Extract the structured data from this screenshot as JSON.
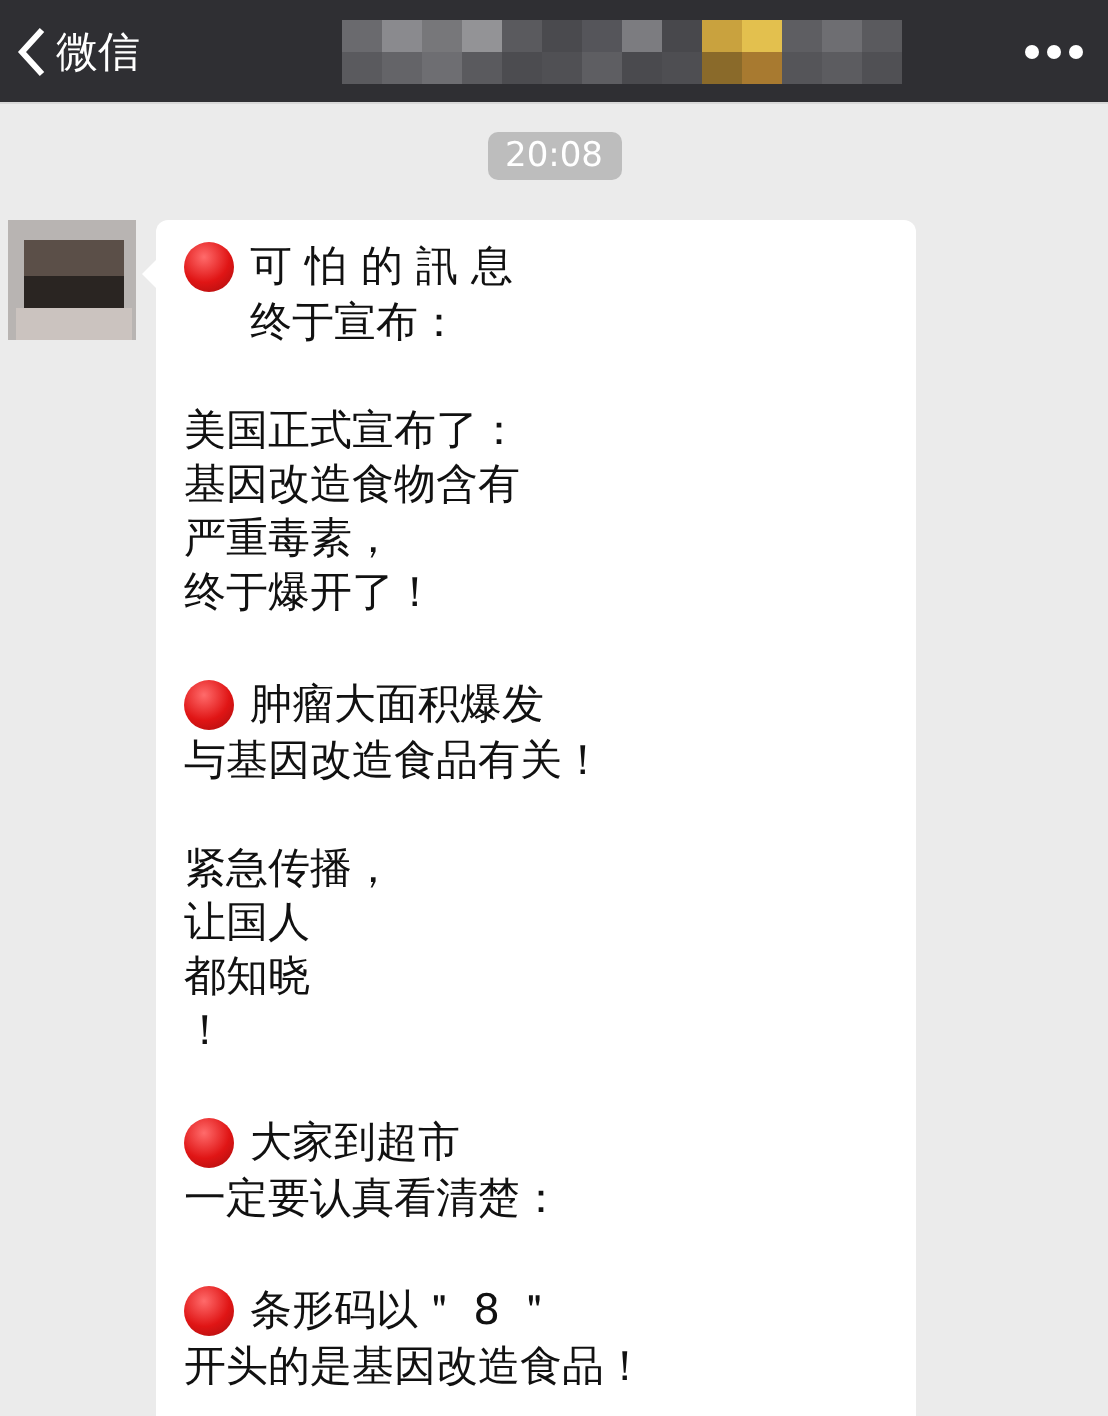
{
  "nav_bar": {
    "back_label": "微信"
  },
  "timestamp": "20:08",
  "message": {
    "paragraphs": [
      {
        "lines": [
          {
            "kind": "bullet",
            "text": "可 怕 的 訊 息"
          },
          {
            "kind": "indented",
            "text": "终于宣布："
          }
        ]
      },
      {
        "lines": [
          {
            "kind": "plain",
            "text": "美国正式宣布了："
          },
          {
            "kind": "plain",
            "text": "基因改造食物含有"
          },
          {
            "kind": "plain",
            "text": "严重毒素，"
          },
          {
            "kind": "plain",
            "text": "终于爆开了！"
          }
        ]
      },
      {
        "lines": [
          {
            "kind": "bullet",
            "text": "肿瘤大面积爆发"
          },
          {
            "kind": "plain",
            "text": "与基因改造食品有关！"
          }
        ]
      },
      {
        "lines": [
          {
            "kind": "plain",
            "text": "紧急传播，"
          },
          {
            "kind": "plain",
            "text": "让国人"
          },
          {
            "kind": "plain",
            "text": "都知晓"
          },
          {
            "kind": "plain",
            "text": "！"
          }
        ]
      },
      {
        "lines": [
          {
            "kind": "bullet",
            "text": "大家到超市"
          },
          {
            "kind": "plain",
            "text": "一定要认真看清楚："
          }
        ]
      },
      {
        "lines": [
          {
            "kind": "bullet",
            "text": "条形码以＂ 8 ＂"
          },
          {
            "kind": "plain",
            "text": "开头的是基因改造食品！"
          }
        ]
      }
    ]
  }
}
